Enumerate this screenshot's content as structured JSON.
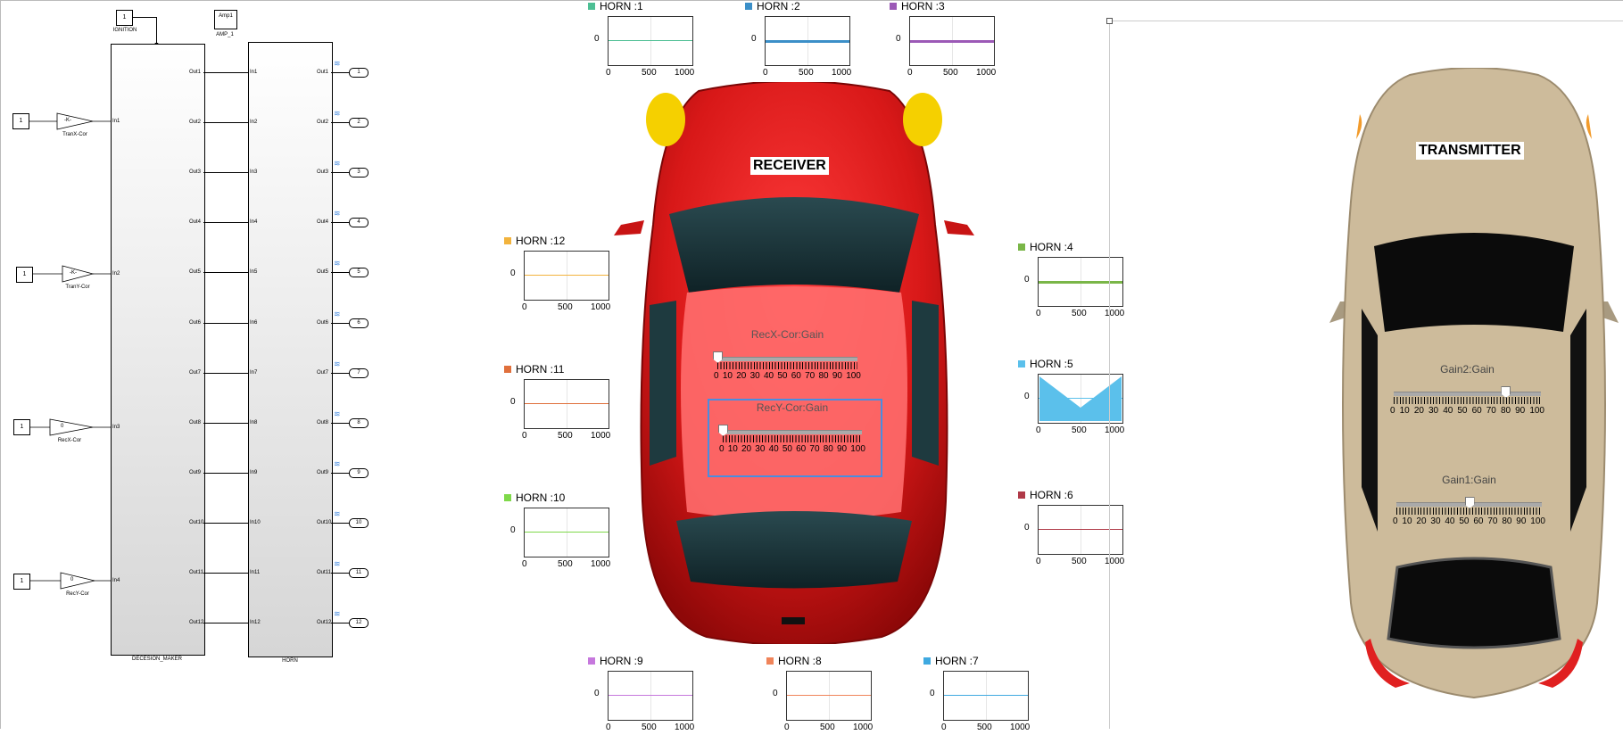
{
  "model": {
    "ignition": {
      "value": "1",
      "label": "IGNITION"
    },
    "amp": {
      "value": "Amp1",
      "label": "AMP_1"
    },
    "constants": [
      "1",
      "1",
      "1",
      "1"
    ],
    "gains": [
      {
        "value": "-K-",
        "label": "TranX-Cor"
      },
      {
        "value": "-K-",
        "label": "TranY-Cor"
      },
      {
        "value": "0",
        "label": "RecX-Cor"
      },
      {
        "value": "0",
        "label": "RecY-Cor"
      }
    ],
    "decision_maker": {
      "label": "DECESION_MAKER",
      "inputs": [
        "In1",
        "In2",
        "In3",
        "In4"
      ],
      "outputs": [
        "Out1",
        "Out2",
        "Out3",
        "Out4",
        "Out5",
        "Out6",
        "Out7",
        "Out8",
        "Out9",
        "Out10",
        "Out11",
        "Out12"
      ]
    },
    "horn_block": {
      "label": "HORN",
      "inputs": [
        "In1",
        "In2",
        "In3",
        "In4",
        "In5",
        "In6",
        "In7",
        "In8",
        "In9",
        "In10",
        "In11",
        "In12"
      ],
      "outputs": [
        "Out1",
        "Out2",
        "Out3",
        "Out4",
        "Out5",
        "Out6",
        "Out7",
        "Out8",
        "Out9",
        "Out10",
        "Out11",
        "Out12"
      ]
    },
    "outports": [
      "1",
      "2",
      "3",
      "4",
      "5",
      "6",
      "7",
      "8",
      "9",
      "10",
      "11",
      "12"
    ]
  },
  "scopes": [
    {
      "title": "HORN :1",
      "color": "#4dbf94"
    },
    {
      "title": "HORN :2",
      "color": "#3b8fc8"
    },
    {
      "title": "HORN :3",
      "color": "#9b59b6"
    },
    {
      "title": "HORN :4",
      "color": "#7ab648"
    },
    {
      "title": "HORN :5",
      "color": "#5bc0eb"
    },
    {
      "title": "HORN :6",
      "color": "#b03a48"
    },
    {
      "title": "HORN :7",
      "color": "#3fa9e0"
    },
    {
      "title": "HORN :8",
      "color": "#f0845a"
    },
    {
      "title": "HORN :9",
      "color": "#c678dd"
    },
    {
      "title": "HORN :10",
      "color": "#7fd94a"
    },
    {
      "title": "HORN :11",
      "color": "#e0703c"
    },
    {
      "title": "HORN :12",
      "color": "#f2b33d"
    }
  ],
  "scope_axis": {
    "y": "0",
    "x": [
      "0",
      "500",
      "1000"
    ]
  },
  "receiver": {
    "label": "RECEIVER",
    "sliders": [
      {
        "title": "RecX-Cor:Gain",
        "value": 0,
        "ticks": [
          "0",
          "10",
          "20",
          "30",
          "40",
          "50",
          "60",
          "70",
          "80",
          "90",
          "100"
        ]
      },
      {
        "title": "RecY-Cor:Gain",
        "value": 0,
        "ticks": [
          "0",
          "10",
          "20",
          "30",
          "40",
          "50",
          "60",
          "70",
          "80",
          "90",
          "100"
        ]
      }
    ]
  },
  "transmitter": {
    "label": "TRANSMITTER",
    "sliders": [
      {
        "title": "Gain2:Gain",
        "value": 76,
        "ticks": [
          "0",
          "10",
          "20",
          "30",
          "40",
          "50",
          "60",
          "70",
          "80",
          "90",
          "100"
        ]
      },
      {
        "title": "Gain1:Gain",
        "value": 50,
        "ticks": [
          "0",
          "10",
          "20",
          "30",
          "40",
          "50",
          "60",
          "70",
          "80",
          "90",
          "100"
        ]
      }
    ]
  }
}
